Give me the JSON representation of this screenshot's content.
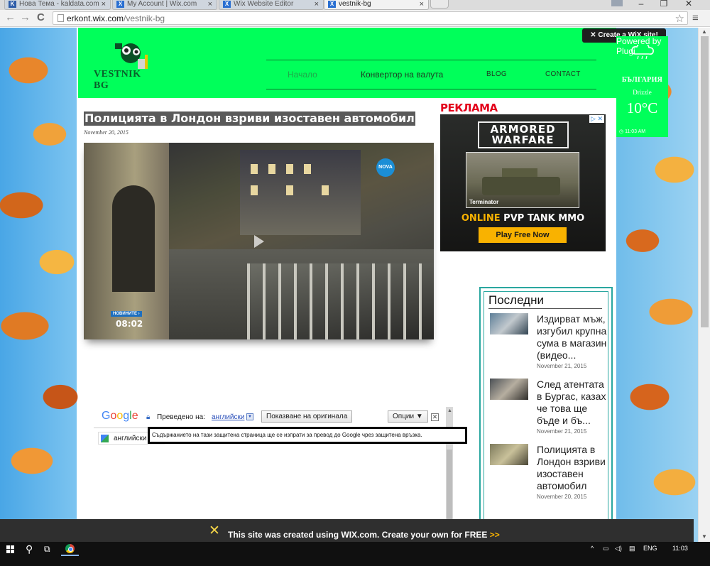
{
  "browser": {
    "tabs": [
      {
        "label": "Нова Тема - kaldata.com",
        "icon": "kaldata-favicon"
      },
      {
        "label": "My Account | Wix.com",
        "icon": "wix-favicon"
      },
      {
        "label": "Wix Website Editor",
        "icon": "wix-favicon"
      },
      {
        "label": "vestnik-bg",
        "icon": "wix-favicon",
        "active": true
      }
    ],
    "tab_close_glyph": "×",
    "window_controls": {
      "minimize": "–",
      "maximize": "❐",
      "close": "✕"
    },
    "nav": {
      "back": "←",
      "forward": "→",
      "reload": "C"
    },
    "url_host": "erkont.wix.com",
    "url_path": "/vestnik-bg",
    "star": "☆",
    "menu": "≡"
  },
  "site": {
    "logo_text": "VESTNIK BG",
    "nav": [
      {
        "label": "Начало",
        "active": true
      },
      {
        "label": "Конвертор на валута"
      },
      {
        "label": "BLOG"
      },
      {
        "label": "CONTACT"
      }
    ],
    "article": {
      "title": "Полицията в Лондон взриви изоставен автомобил",
      "date": "November 20, 2015",
      "video": {
        "channel_logo": "NOVA",
        "badge": "НОВИНИТЕ ›",
        "time": "08:02"
      }
    },
    "ad": {
      "heading": "РЕКЛАМА",
      "game_title_1": "ARMORED",
      "game_title_2": "WARFARE",
      "image_caption": "Terminator",
      "tagline_highlight": "ONLINE",
      "tagline_rest": " PVP TANK MMO",
      "cta": "Play Free Now",
      "adchoices": "▷ ✕"
    },
    "latest": {
      "title": "Последни",
      "posts": [
        {
          "title": "Издирват мъж, изгубил крупна сума в магазин (видео...",
          "date": "November 21, 2015"
        },
        {
          "title": "След атентата в Бургас, казах че това ще бъде и бъ...",
          "date": "November 21, 2015"
        },
        {
          "title": "Полицията в Лондон взриви изоставен автомобил",
          "date": "November 20, 2015"
        }
      ]
    }
  },
  "translate_bar": {
    "logo": {
      "G": "G",
      "o1": "o",
      "o2": "o",
      "g": "g",
      "l": "l",
      "e": "e"
    },
    "label": "Преведено на:",
    "language": "английски",
    "show_original": "Показване на оригинала",
    "options": "Опции ▼",
    "close": "✕",
    "lang_row": "английски",
    "tooltip": "Съдържанието на тази защитена страница ще се изпрати за превод до Google чрез защитена връзка."
  },
  "weather": {
    "country": "БЪЛГАРИЯ",
    "condition": "Drizzle",
    "temperature": "10°C",
    "time": "11:03 AM",
    "powered_by": "Powered by Plugi"
  },
  "wix": {
    "create_site": "Create a WiX site!",
    "banner_text": "This site was created using WIX.com. Create your own for FREE",
    "banner_arrows": ">>"
  },
  "taskbar": {
    "tray_up": "^",
    "language": "ENG",
    "clock": "11:03"
  },
  "colors": {
    "header_green": "#00ff5a",
    "accent_red": "#e3001b",
    "teal_border": "#2aa7a0",
    "ad_yellow": "#f9b200"
  }
}
